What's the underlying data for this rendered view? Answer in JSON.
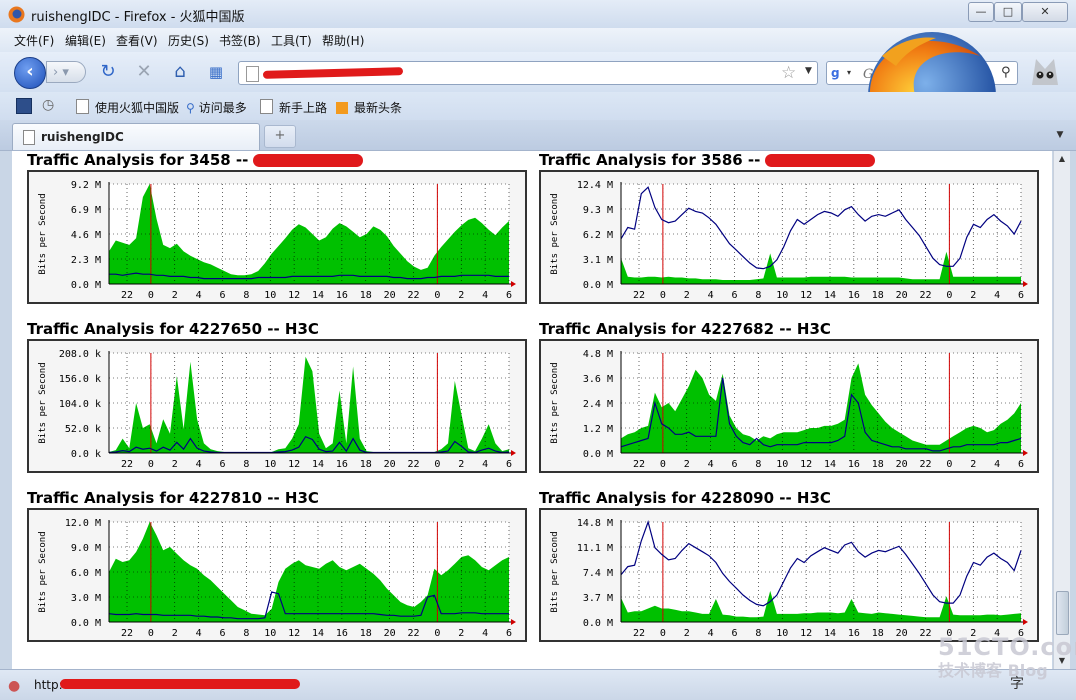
{
  "window": {
    "title": "ruishengIDC - Firefox - 火狐中国版",
    "min": "—",
    "max": "□",
    "close": "✕"
  },
  "menu": [
    "文件(F)",
    "编辑(E)",
    "查看(V)",
    "历史(S)",
    "书签(B)",
    "工具(T)",
    "帮助(H)"
  ],
  "search": {
    "placeholder": "Google",
    "engine_icon": "google-icon"
  },
  "bookmarks": [
    "使用火狐中国版",
    "访问最多",
    "新手上路",
    "最新头条"
  ],
  "tab": {
    "label": "ruishengIDC",
    "new_tab": "+"
  },
  "status": {
    "text": "http:"
  },
  "watermark": {
    "line1": "51CTO.com",
    "line2": "技术博客 Blog"
  },
  "ime_char": "字",
  "colors": {
    "area": "#00c000",
    "line": "#000080",
    "marker": "#d00000",
    "grid": "#000000"
  },
  "chart_data": [
    {
      "type": "area",
      "title": "Traffic Analysis for 3458 -- ",
      "ylabel": "Bits per Second",
      "y_ticks": [
        "0.0 M",
        "2.3 M",
        "4.6 M",
        "6.9 M",
        "9.2 M"
      ],
      "ylim": [
        0,
        9.2
      ],
      "x_ticks": [
        "22",
        "0",
        "2",
        "4",
        "6",
        "8",
        "10",
        "12",
        "14",
        "16",
        "18",
        "20",
        "22",
        "0",
        "2",
        "4",
        "6"
      ],
      "series": [
        {
          "kind": "in",
          "values": [
            3.0,
            4.0,
            3.8,
            3.6,
            4.2,
            8.0,
            9.2,
            6.0,
            3.6,
            3.3,
            3.7,
            3.0,
            2.6,
            2.3,
            2.0,
            1.8,
            1.5,
            1.2,
            0.9,
            0.8,
            0.8,
            0.9,
            1.2,
            1.9,
            2.8,
            3.5,
            4.2,
            5.0,
            5.5,
            5.2,
            4.6,
            4.0,
            4.3,
            5.1,
            5.6,
            5.3,
            4.8,
            4.3,
            4.6,
            5.3,
            5.0,
            4.4,
            3.5,
            2.8,
            2.1,
            1.6,
            1.3,
            1.5,
            2.6,
            3.4,
            4.1,
            4.8,
            5.4,
            5.9,
            6.1,
            5.6,
            5.0,
            4.5,
            5.2,
            5.8
          ]
        },
        {
          "kind": "out",
          "values": [
            0.9,
            0.9,
            0.8,
            0.9,
            1.0,
            0.9,
            0.9,
            0.8,
            0.8,
            0.7,
            0.7,
            0.7,
            0.6,
            0.6,
            0.5,
            0.5,
            0.5,
            0.5,
            0.5,
            0.5,
            0.5,
            0.5,
            0.6,
            0.6,
            0.6,
            0.6,
            0.6,
            0.7,
            0.7,
            0.7,
            0.7,
            0.7,
            0.7,
            0.7,
            0.8,
            0.8,
            0.8,
            0.7,
            0.7,
            0.7,
            0.7,
            0.7,
            0.6,
            0.6,
            0.5,
            0.5,
            0.5,
            0.6,
            0.6,
            0.7,
            0.7,
            0.7,
            0.8,
            0.8,
            0.8,
            0.8,
            0.8,
            0.7,
            0.7,
            0.7
          ]
        }
      ]
    },
    {
      "type": "area",
      "title": "Traffic Analysis for 3586 -- ",
      "ylabel": "Bits per Second",
      "y_ticks": [
        "0.0 M",
        "3.1 M",
        "6.2 M",
        "9.3 M",
        "12.4 M"
      ],
      "ylim": [
        0,
        12.4
      ],
      "x_ticks": [
        "22",
        "0",
        "2",
        "4",
        "6",
        "8",
        "10",
        "12",
        "14",
        "16",
        "18",
        "20",
        "22",
        "0",
        "2",
        "4",
        "6"
      ],
      "series": [
        {
          "kind": "in",
          "values": [
            3.2,
            0.9,
            0.8,
            0.8,
            0.9,
            0.9,
            0.8,
            0.9,
            0.8,
            0.8,
            0.7,
            0.7,
            0.6,
            0.6,
            0.6,
            0.5,
            0.5,
            0.5,
            0.5,
            0.5,
            0.6,
            0.7,
            3.8,
            0.8,
            0.8,
            0.8,
            0.8,
            0.8,
            0.9,
            0.9,
            0.9,
            0.9,
            0.9,
            0.9,
            0.8,
            0.8,
            0.8,
            0.8,
            0.8,
            0.8,
            0.8,
            0.8,
            0.7,
            0.6,
            0.6,
            0.6,
            0.6,
            0.6,
            4.0,
            0.9,
            0.9,
            0.9,
            0.9,
            0.9,
            0.9,
            0.9,
            0.9,
            0.9,
            0.9,
            0.9
          ]
        },
        {
          "kind": "out",
          "values": [
            5.6,
            7.0,
            6.8,
            11.2,
            12.0,
            9.5,
            8.0,
            7.6,
            7.8,
            8.6,
            9.4,
            9.0,
            8.8,
            8.2,
            7.4,
            6.2,
            5.0,
            4.2,
            3.4,
            2.6,
            2.0,
            1.9,
            2.2,
            3.0,
            4.6,
            6.6,
            8.0,
            7.4,
            8.0,
            8.6,
            9.0,
            8.8,
            8.4,
            9.2,
            9.6,
            8.6,
            7.8,
            8.4,
            8.6,
            8.4,
            8.8,
            9.2,
            8.0,
            7.0,
            6.0,
            4.6,
            3.2,
            2.4,
            2.2,
            2.2,
            3.2,
            5.8,
            7.4,
            7.0,
            8.0,
            8.6,
            7.8,
            7.2,
            6.2,
            7.8
          ]
        }
      ]
    },
    {
      "type": "area",
      "title": "Traffic Analysis for 4227650 -- H3C",
      "ylabel": "Bits per Second",
      "y_ticks": [
        "0.0 k",
        "52.0 k",
        "104.0 k",
        "156.0 k",
        "208.0 k"
      ],
      "ylim": [
        0,
        208
      ],
      "x_ticks": [
        "22",
        "0",
        "2",
        "4",
        "6",
        "8",
        "10",
        "12",
        "14",
        "16",
        "18",
        "20",
        "22",
        "0",
        "2",
        "4",
        "6"
      ],
      "series": [
        {
          "kind": "in",
          "values": [
            2,
            6,
            30,
            10,
            104,
            52,
            60,
            20,
            70,
            40,
            160,
            50,
            190,
            70,
            20,
            8,
            4,
            2,
            2,
            2,
            2,
            2,
            2,
            2,
            2,
            8,
            10,
            30,
            60,
            200,
            170,
            40,
            10,
            20,
            130,
            20,
            180,
            30,
            4,
            2,
            2,
            2,
            2,
            2,
            2,
            2,
            2,
            2,
            2,
            8,
            20,
            150,
            80,
            10,
            4,
            30,
            60,
            20,
            4,
            8
          ]
        },
        {
          "kind": "out",
          "values": [
            1,
            2,
            5,
            3,
            12,
            8,
            10,
            4,
            12,
            6,
            22,
            8,
            30,
            10,
            4,
            2,
            1,
            1,
            1,
            1,
            1,
            1,
            1,
            1,
            1,
            2,
            3,
            6,
            12,
            34,
            28,
            8,
            3,
            4,
            22,
            4,
            30,
            6,
            1,
            1,
            1,
            1,
            1,
            1,
            1,
            1,
            1,
            1,
            1,
            2,
            4,
            24,
            14,
            2,
            1,
            6,
            10,
            4,
            1,
            2
          ]
        }
      ]
    },
    {
      "type": "area",
      "title": "Traffic Analysis for 4227682 -- H3C",
      "ylabel": "Bits per Second",
      "y_ticks": [
        "0.0 M",
        "1.2 M",
        "2.4 M",
        "3.6 M",
        "4.8 M"
      ],
      "ylim": [
        0,
        4.8
      ],
      "x_ticks": [
        "22",
        "0",
        "2",
        "4",
        "6",
        "8",
        "10",
        "12",
        "14",
        "16",
        "18",
        "20",
        "22",
        "0",
        "2",
        "4",
        "6"
      ],
      "series": [
        {
          "kind": "in",
          "values": [
            0.7,
            0.9,
            1.0,
            1.2,
            1.3,
            2.9,
            2.2,
            2.4,
            2.0,
            2.6,
            3.2,
            4.0,
            3.6,
            2.8,
            2.5,
            3.8,
            1.8,
            1.2,
            0.9,
            0.8,
            0.6,
            0.8,
            0.7,
            0.9,
            1.0,
            1.0,
            1.0,
            1.1,
            1.2,
            1.2,
            1.3,
            1.3,
            1.4,
            1.6,
            3.6,
            4.3,
            2.8,
            2.3,
            1.9,
            1.5,
            1.2,
            1.0,
            0.8,
            0.6,
            0.5,
            0.4,
            0.4,
            0.4,
            0.6,
            0.8,
            1.0,
            1.2,
            1.3,
            1.2,
            1.0,
            1.1,
            1.4,
            1.6,
            1.9,
            2.4
          ]
        },
        {
          "kind": "out",
          "values": [
            0.3,
            0.4,
            0.5,
            0.6,
            0.7,
            2.4,
            1.4,
            1.2,
            0.9,
            0.9,
            1.0,
            0.8,
            0.8,
            0.8,
            0.8,
            3.6,
            1.4,
            0.8,
            0.5,
            0.4,
            0.7,
            0.4,
            0.3,
            0.4,
            0.4,
            0.4,
            0.4,
            0.5,
            0.5,
            0.5,
            0.5,
            0.5,
            0.6,
            0.8,
            2.8,
            2.4,
            1.0,
            0.6,
            0.5,
            0.4,
            0.3,
            0.3,
            0.2,
            0.2,
            0.2,
            0.2,
            0.1,
            0.1,
            0.2,
            0.3,
            0.3,
            0.4,
            0.4,
            0.4,
            0.4,
            0.4,
            0.5,
            0.5,
            0.6,
            0.7
          ]
        }
      ]
    },
    {
      "type": "area",
      "title": "Traffic Analysis for 4227810 -- H3C",
      "ylabel": "Bits per Second",
      "y_ticks": [
        "0.0 M",
        "3.0 M",
        "6.0 M",
        "9.0 M",
        "12.0 M"
      ],
      "ylim": [
        0,
        12.0
      ],
      "x_ticks": [
        "22",
        "0",
        "2",
        "4",
        "6",
        "8",
        "10",
        "12",
        "14",
        "16",
        "18",
        "20",
        "22",
        "0",
        "2",
        "4",
        "6"
      ],
      "series": [
        {
          "kind": "in",
          "values": [
            6.0,
            7.6,
            7.2,
            7.4,
            8.4,
            10.0,
            12.0,
            10.4,
            8.6,
            9.0,
            8.2,
            7.4,
            6.8,
            6.4,
            5.6,
            5.0,
            4.2,
            3.4,
            2.6,
            1.8,
            1.4,
            1.0,
            0.9,
            0.8,
            1.6,
            4.8,
            6.4,
            7.0,
            7.4,
            6.8,
            6.6,
            6.4,
            7.0,
            7.4,
            6.6,
            6.2,
            6.6,
            7.0,
            6.4,
            5.8,
            5.0,
            4.0,
            3.2,
            2.4,
            2.0,
            1.8,
            2.4,
            3.2,
            6.4,
            5.6,
            6.2,
            7.0,
            7.8,
            8.0,
            7.4,
            6.6,
            6.2,
            6.8,
            7.4,
            7.8
          ]
        },
        {
          "kind": "out",
          "values": [
            1.0,
            0.9,
            0.9,
            0.9,
            1.0,
            0.9,
            0.9,
            0.9,
            0.8,
            0.8,
            0.8,
            0.8,
            0.8,
            0.7,
            0.7,
            0.6,
            0.6,
            0.5,
            0.5,
            0.4,
            0.4,
            0.4,
            0.4,
            0.5,
            3.6,
            3.4,
            1.0,
            1.0,
            1.0,
            1.0,
            1.0,
            1.0,
            1.0,
            1.0,
            1.0,
            1.0,
            1.0,
            1.0,
            1.0,
            1.0,
            0.9,
            0.8,
            0.8,
            0.7,
            0.7,
            0.7,
            0.8,
            3.0,
            3.2,
            1.0,
            1.0,
            1.0,
            1.1,
            1.1,
            1.1,
            1.0,
            1.0,
            1.0,
            1.0,
            1.0
          ]
        }
      ]
    },
    {
      "type": "area",
      "title": "Traffic Analysis for 4228090 -- H3C",
      "ylabel": "Bits per Second",
      "y_ticks": [
        "0.0 M",
        "3.7 M",
        "7.4 M",
        "11.1 M",
        "14.8 M"
      ],
      "ylim": [
        0,
        14.8
      ],
      "x_ticks": [
        "22",
        "0",
        "2",
        "4",
        "6",
        "8",
        "10",
        "12",
        "14",
        "16",
        "18",
        "20",
        "22",
        "0",
        "2",
        "4",
        "6"
      ],
      "series": [
        {
          "kind": "in",
          "values": [
            3.6,
            1.4,
            1.6,
            1.6,
            2.0,
            2.4,
            2.0,
            2.0,
            1.8,
            1.6,
            1.6,
            1.4,
            1.2,
            1.2,
            3.4,
            1.1,
            1.0,
            0.8,
            0.8,
            0.7,
            0.7,
            0.8,
            4.6,
            1.2,
            1.2,
            1.2,
            1.2,
            1.3,
            1.3,
            1.4,
            1.4,
            1.4,
            1.3,
            1.4,
            3.4,
            1.4,
            1.3,
            1.2,
            1.4,
            1.3,
            1.2,
            1.1,
            1.0,
            0.9,
            0.8,
            0.7,
            0.7,
            0.7,
            3.8,
            1.1,
            1.0,
            1.0,
            1.0,
            1.0,
            1.1,
            1.1,
            1.0,
            1.1,
            1.2,
            1.3
          ]
        },
        {
          "kind": "out",
          "values": [
            7.0,
            8.2,
            8.4,
            12.0,
            14.8,
            11.0,
            10.0,
            9.2,
            9.4,
            10.6,
            11.6,
            11.0,
            10.4,
            9.8,
            8.8,
            7.2,
            6.0,
            5.0,
            4.0,
            3.2,
            2.6,
            2.4,
            3.0,
            4.0,
            6.0,
            8.0,
            9.4,
            8.8,
            9.8,
            10.4,
            11.0,
            10.6,
            10.2,
            11.4,
            11.8,
            10.4,
            9.6,
            10.2,
            10.6,
            10.4,
            10.8,
            11.2,
            10.0,
            8.6,
            7.2,
            5.6,
            4.0,
            3.0,
            2.8,
            2.8,
            4.0,
            6.8,
            8.8,
            8.4,
            9.6,
            10.2,
            9.4,
            8.8,
            7.6,
            10.6
          ]
        }
      ]
    }
  ]
}
